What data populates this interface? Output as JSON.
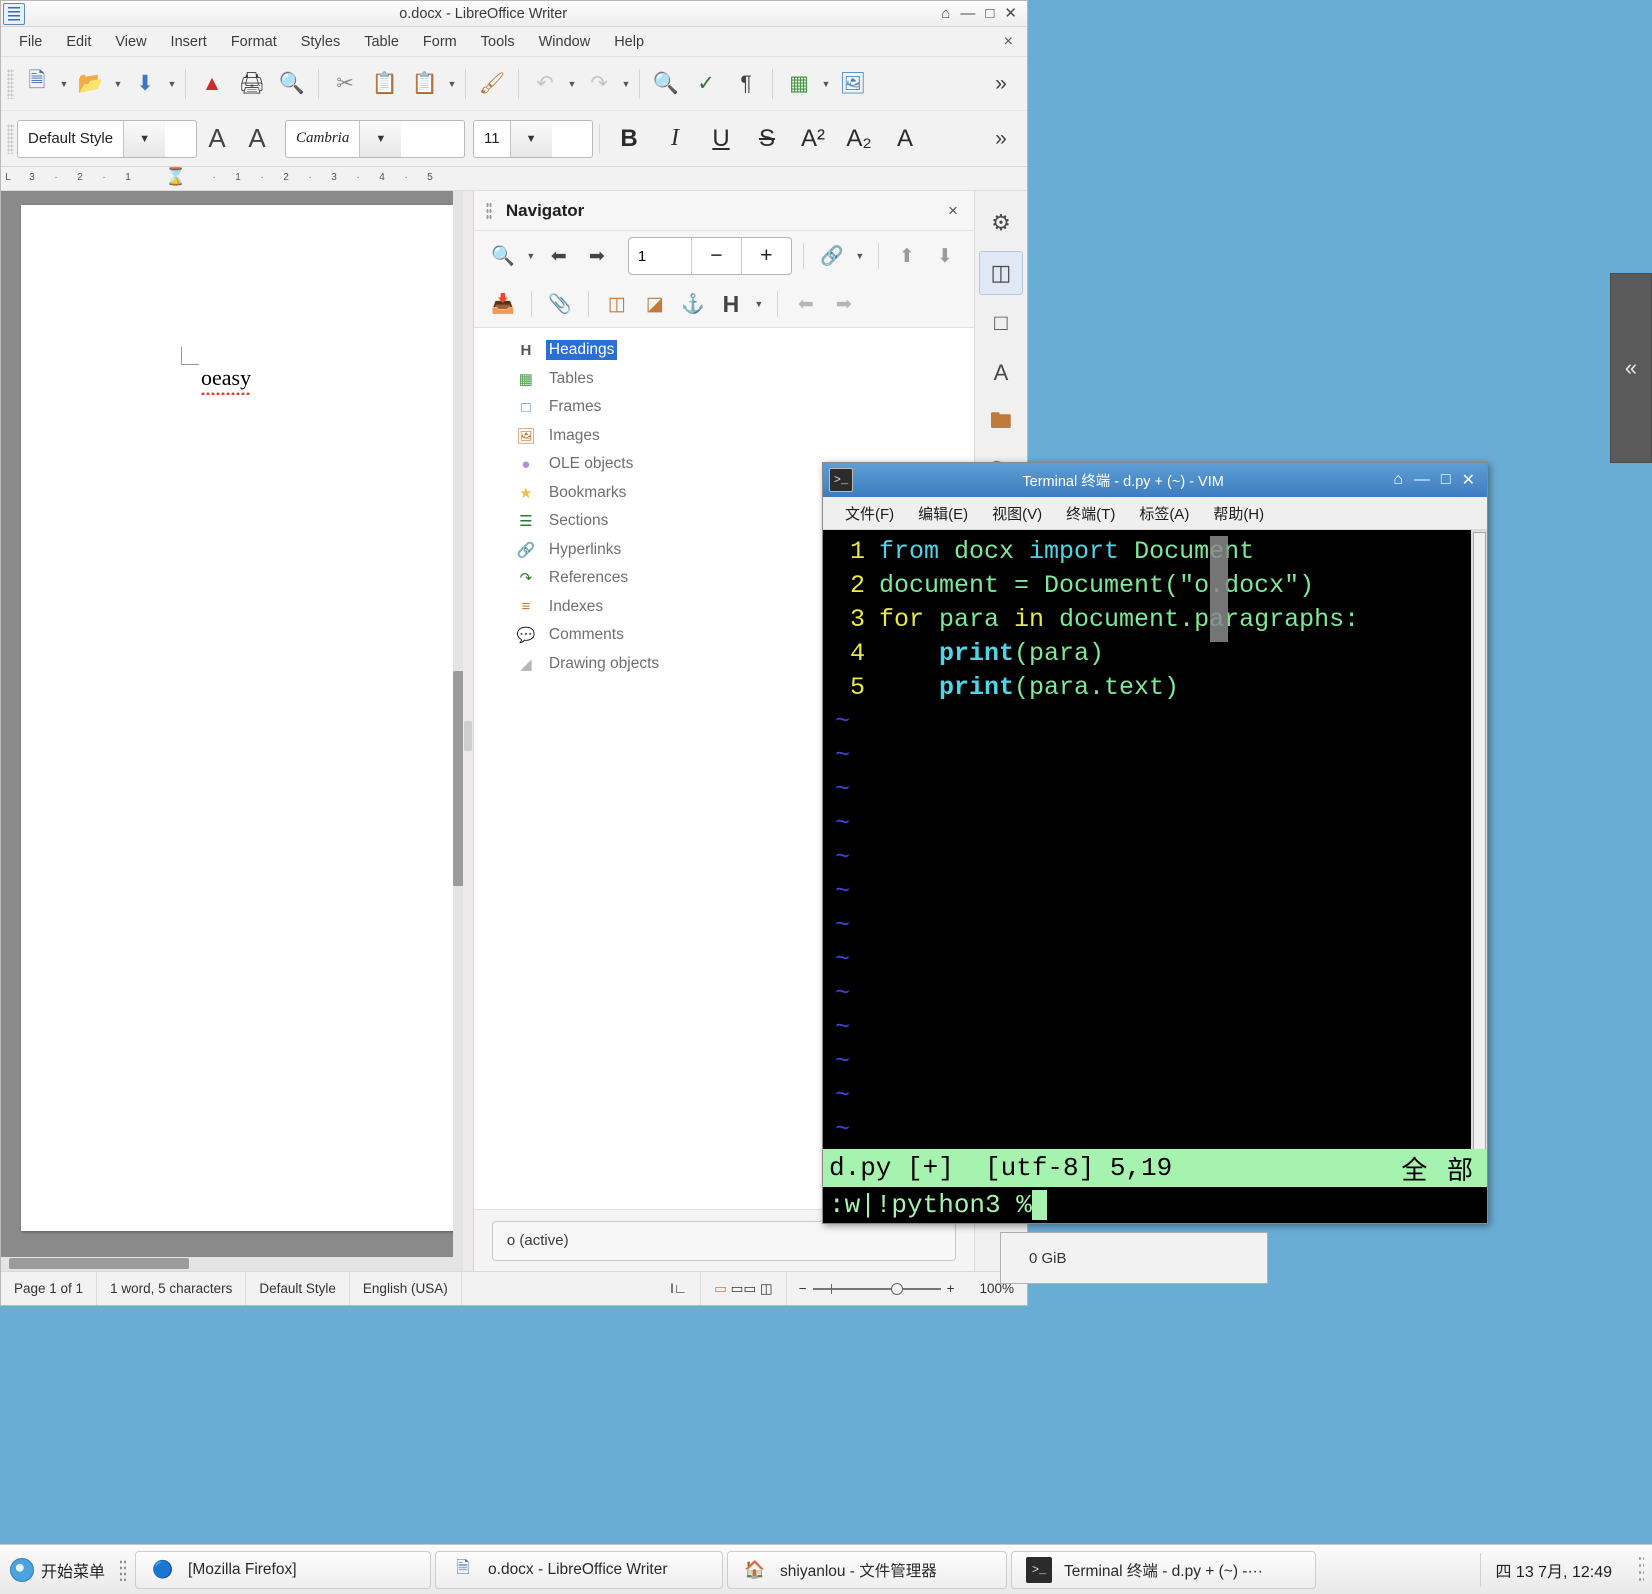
{
  "writer": {
    "title": "o.docx - LibreOffice Writer",
    "menu": [
      "File",
      "Edit",
      "View",
      "Insert",
      "Format",
      "Styles",
      "Table",
      "Form",
      "Tools",
      "Window",
      "Help"
    ],
    "doc_close_label": "×",
    "window_buttons": {
      "minimize": "—",
      "maximize": "□",
      "close": "✕",
      "restore": "⌂"
    },
    "toolbar2": {
      "paragraph_style": "Default Style",
      "font_name": "Cambria",
      "font_size": "11",
      "bold": "B",
      "italic": "I",
      "underline": "U",
      "strikethrough": "S",
      "superscript": "A²",
      "subscript": "A₂",
      "clear_formatting": "A",
      "overflow": "»"
    },
    "ruler_labels": [
      "3",
      "2",
      "1",
      "1",
      "2",
      "3",
      "4",
      "5"
    ],
    "document": {
      "text": "oeasy"
    },
    "statusbar": {
      "page": "Page 1 of 1",
      "words": "1 word, 5 characters",
      "style": "Default Style",
      "language": "English (USA)",
      "zoom": "100%",
      "zoom_out": "−",
      "zoom_in": "+"
    }
  },
  "navigator": {
    "title": "Navigator",
    "close_label": "×",
    "page_number": "1",
    "decrement": "−",
    "increment": "+",
    "header_toggle": "H",
    "items": [
      {
        "label": "Headings",
        "icon": "headings-icon",
        "selected": true
      },
      {
        "label": "Tables",
        "icon": "table-icon",
        "selected": false
      },
      {
        "label": "Frames",
        "icon": "frame-icon",
        "selected": false
      },
      {
        "label": "Images",
        "icon": "image-icon",
        "selected": false
      },
      {
        "label": "OLE objects",
        "icon": "ole-object-icon",
        "selected": false
      },
      {
        "label": "Bookmarks",
        "icon": "bookmark-star-icon",
        "selected": false
      },
      {
        "label": "Sections",
        "icon": "section-icon",
        "selected": false
      },
      {
        "label": "Hyperlinks",
        "icon": "hyperlink-icon",
        "selected": false
      },
      {
        "label": "References",
        "icon": "reference-icon",
        "selected": false
      },
      {
        "label": "Indexes",
        "icon": "index-icon",
        "selected": false
      },
      {
        "label": "Comments",
        "icon": "comment-icon",
        "selected": false
      },
      {
        "label": "Drawing objects",
        "icon": "drawing-object-icon",
        "selected": false
      }
    ],
    "document_selector": "o (active)"
  },
  "sidebar_rail": {
    "items": [
      "settings-icon",
      "properties-icon",
      "page-icon",
      "styles-icon",
      "gallery-icon",
      "navigator-icon"
    ]
  },
  "terminal": {
    "title": "Terminal 终端 - d.py + (~) - VIM",
    "menu": [
      "文件(F)",
      "编辑(E)",
      "视图(V)",
      "终端(T)",
      "标签(A)",
      "帮助(H)"
    ],
    "window_buttons": {
      "restore": "⌂",
      "minimize": "—",
      "maximize": "□",
      "close": "✕"
    },
    "editor": {
      "lines": [
        {
          "n": "1",
          "tokens": [
            {
              "t": "from ",
              "c": "blue"
            },
            {
              "t": "docx ",
              "c": "green"
            },
            {
              "t": "import ",
              "c": "blue"
            },
            {
              "t": "Document",
              "c": "green"
            }
          ]
        },
        {
          "n": "2",
          "tokens": [
            {
              "t": "document = Document(",
              "c": "green"
            },
            {
              "t": "\"o.docx\"",
              "c": "green"
            },
            {
              "t": ")",
              "c": "green"
            }
          ]
        },
        {
          "n": "3",
          "tokens": [
            {
              "t": "for ",
              "c": "kw"
            },
            {
              "t": "para ",
              "c": "green"
            },
            {
              "t": "in ",
              "c": "kw"
            },
            {
              "t": "document.paragraphs:",
              "c": "green"
            }
          ]
        },
        {
          "n": "4",
          "tokens": [
            {
              "t": "    ",
              "c": "green"
            },
            {
              "t": "print",
              "c": "bold"
            },
            {
              "t": "(para)",
              "c": "green"
            }
          ]
        },
        {
          "n": "5",
          "tokens": [
            {
              "t": "    ",
              "c": "green"
            },
            {
              "t": "print",
              "c": "bold"
            },
            {
              "t": "(para.text)",
              "c": "green"
            }
          ]
        }
      ],
      "empty_marker": "~",
      "empty_count": 13
    },
    "status_left": "d.py [+]  [utf-8] 5,19",
    "status_right": "全 部",
    "command_line": ":w|!python3 %"
  },
  "behind_window": {
    "text": "0 GiB"
  },
  "taskbar": {
    "start_label": "开始菜单",
    "tasks": [
      {
        "label": "[Mozilla Firefox]",
        "icon": "firefox-icon"
      },
      {
        "label": "o.docx - LibreOffice Writer",
        "icon": "writer-doc-icon"
      },
      {
        "label": "shiyanlou - 文件管理器",
        "icon": "home-folder-icon"
      },
      {
        "label": "Terminal 终端 - d.py + (~) -···",
        "icon": "terminal-icon"
      }
    ],
    "clock": "四 13 7月, 12:49"
  }
}
